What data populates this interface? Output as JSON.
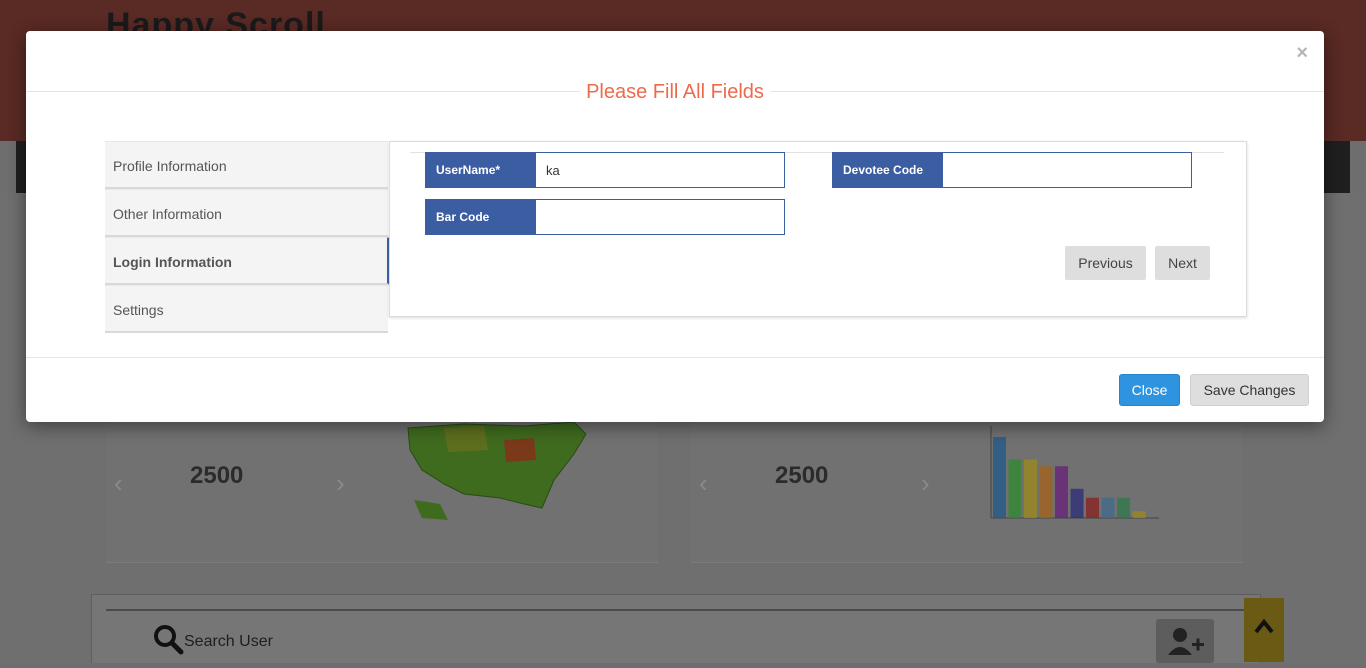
{
  "background": {
    "brand": "Happy Scroll",
    "stat_left": "2500",
    "stat_right": "2500",
    "search_placeholder": "Search User",
    "bar_chart_values": [
      72,
      52,
      52,
      46,
      46,
      26,
      18,
      18,
      18,
      6
    ],
    "bar_chart_colors": [
      "#1f5a8c",
      "#2e8b2e",
      "#9e8a1a",
      "#a5611a",
      "#6a1f7a",
      "#2b2b7a",
      "#8b1f1f",
      "#3f6a8f",
      "#2e7a4a",
      "#9e8a1a"
    ]
  },
  "modal": {
    "title": "Please Fill All Fields",
    "close_glyph": "×",
    "tabs": [
      {
        "label": "Profile Information"
      },
      {
        "label": "Other Information"
      },
      {
        "label": "Login Information"
      },
      {
        "label": "Settings"
      }
    ],
    "fields": {
      "username": {
        "label": "UserName*",
        "value": "ka"
      },
      "devotee_code": {
        "label": "Devotee Code",
        "value": ""
      },
      "bar_code": {
        "label": "Bar Code",
        "value": ""
      }
    },
    "previous_label": "Previous",
    "next_label": "Next",
    "close_label": "Close",
    "save_label": "Save Changes"
  }
}
